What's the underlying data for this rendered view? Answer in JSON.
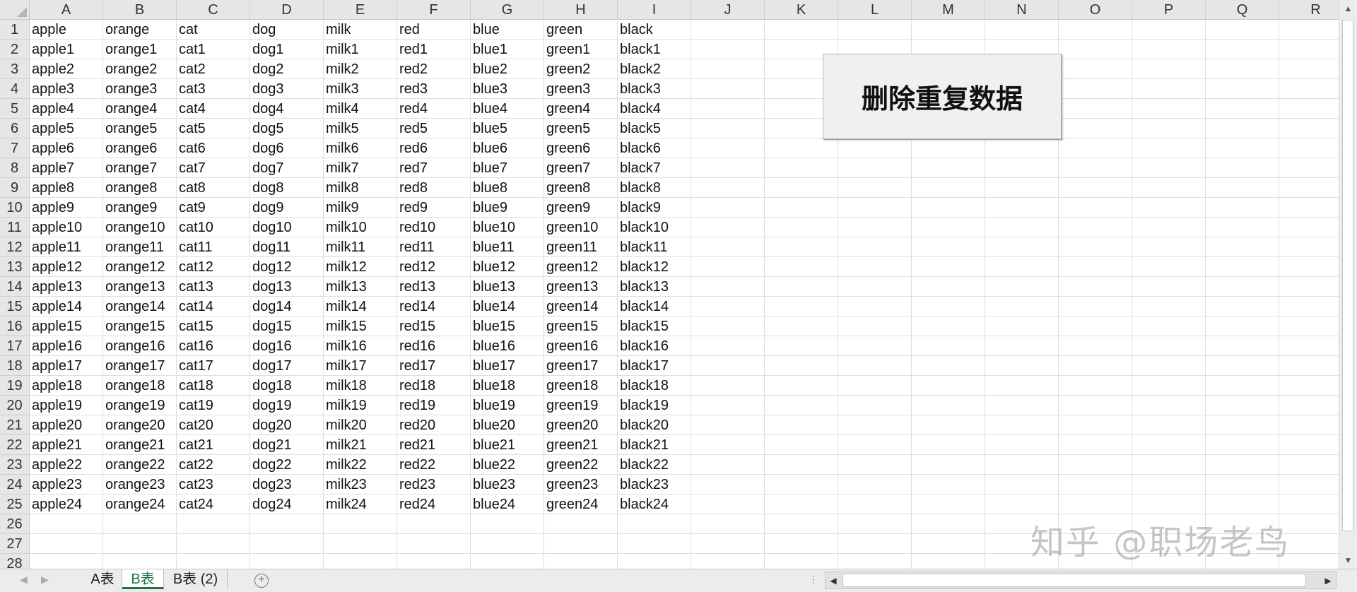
{
  "spreadsheet": {
    "columns": [
      "A",
      "B",
      "C",
      "D",
      "E",
      "F",
      "G",
      "H",
      "I",
      "J",
      "K",
      "L",
      "M",
      "N",
      "O",
      "P",
      "Q",
      "R"
    ],
    "rows": [
      [
        "apple",
        "orange",
        "cat",
        "dog",
        "milk",
        "red",
        "blue",
        "green",
        "black"
      ],
      [
        "apple1",
        "orange1",
        "cat1",
        "dog1",
        "milk1",
        "red1",
        "blue1",
        "green1",
        "black1"
      ],
      [
        "apple2",
        "orange2",
        "cat2",
        "dog2",
        "milk2",
        "red2",
        "blue2",
        "green2",
        "black2"
      ],
      [
        "apple3",
        "orange3",
        "cat3",
        "dog3",
        "milk3",
        "red3",
        "blue3",
        "green3",
        "black3"
      ],
      [
        "apple4",
        "orange4",
        "cat4",
        "dog4",
        "milk4",
        "red4",
        "blue4",
        "green4",
        "black4"
      ],
      [
        "apple5",
        "orange5",
        "cat5",
        "dog5",
        "milk5",
        "red5",
        "blue5",
        "green5",
        "black5"
      ],
      [
        "apple6",
        "orange6",
        "cat6",
        "dog6",
        "milk6",
        "red6",
        "blue6",
        "green6",
        "black6"
      ],
      [
        "apple7",
        "orange7",
        "cat7",
        "dog7",
        "milk7",
        "red7",
        "blue7",
        "green7",
        "black7"
      ],
      [
        "apple8",
        "orange8",
        "cat8",
        "dog8",
        "milk8",
        "red8",
        "blue8",
        "green8",
        "black8"
      ],
      [
        "apple9",
        "orange9",
        "cat9",
        "dog9",
        "milk9",
        "red9",
        "blue9",
        "green9",
        "black9"
      ],
      [
        "apple10",
        "orange10",
        "cat10",
        "dog10",
        "milk10",
        "red10",
        "blue10",
        "green10",
        "black10"
      ],
      [
        "apple11",
        "orange11",
        "cat11",
        "dog11",
        "milk11",
        "red11",
        "blue11",
        "green11",
        "black11"
      ],
      [
        "apple12",
        "orange12",
        "cat12",
        "dog12",
        "milk12",
        "red12",
        "blue12",
        "green12",
        "black12"
      ],
      [
        "apple13",
        "orange13",
        "cat13",
        "dog13",
        "milk13",
        "red13",
        "blue13",
        "green13",
        "black13"
      ],
      [
        "apple14",
        "orange14",
        "cat14",
        "dog14",
        "milk14",
        "red14",
        "blue14",
        "green14",
        "black14"
      ],
      [
        "apple15",
        "orange15",
        "cat15",
        "dog15",
        "milk15",
        "red15",
        "blue15",
        "green15",
        "black15"
      ],
      [
        "apple16",
        "orange16",
        "cat16",
        "dog16",
        "milk16",
        "red16",
        "blue16",
        "green16",
        "black16"
      ],
      [
        "apple17",
        "orange17",
        "cat17",
        "dog17",
        "milk17",
        "red17",
        "blue17",
        "green17",
        "black17"
      ],
      [
        "apple18",
        "orange18",
        "cat18",
        "dog18",
        "milk18",
        "red18",
        "blue18",
        "green18",
        "black18"
      ],
      [
        "apple19",
        "orange19",
        "cat19",
        "dog19",
        "milk19",
        "red19",
        "blue19",
        "green19",
        "black19"
      ],
      [
        "apple20",
        "orange20",
        "cat20",
        "dog20",
        "milk20",
        "red20",
        "blue20",
        "green20",
        "black20"
      ],
      [
        "apple21",
        "orange21",
        "cat21",
        "dog21",
        "milk21",
        "red21",
        "blue21",
        "green21",
        "black21"
      ],
      [
        "apple22",
        "orange22",
        "cat22",
        "dog22",
        "milk22",
        "red22",
        "blue22",
        "green22",
        "black22"
      ],
      [
        "apple23",
        "orange23",
        "cat23",
        "dog23",
        "milk23",
        "red23",
        "blue23",
        "green23",
        "black23"
      ],
      [
        "apple24",
        "orange24",
        "cat24",
        "dog24",
        "milk24",
        "red24",
        "blue24",
        "green24",
        "black24"
      ],
      [],
      [],
      []
    ]
  },
  "macro_button": {
    "label": "删除重复数据"
  },
  "sheet_tabs": [
    {
      "label": "A表",
      "active": false
    },
    {
      "label": "B表",
      "active": true
    },
    {
      "label": "B表 (2)",
      "active": false
    }
  ],
  "watermark": {
    "text": "知乎 @职场老鸟"
  },
  "colors": {
    "active_tab": "#217346",
    "header_bg": "#e6e6e6"
  }
}
